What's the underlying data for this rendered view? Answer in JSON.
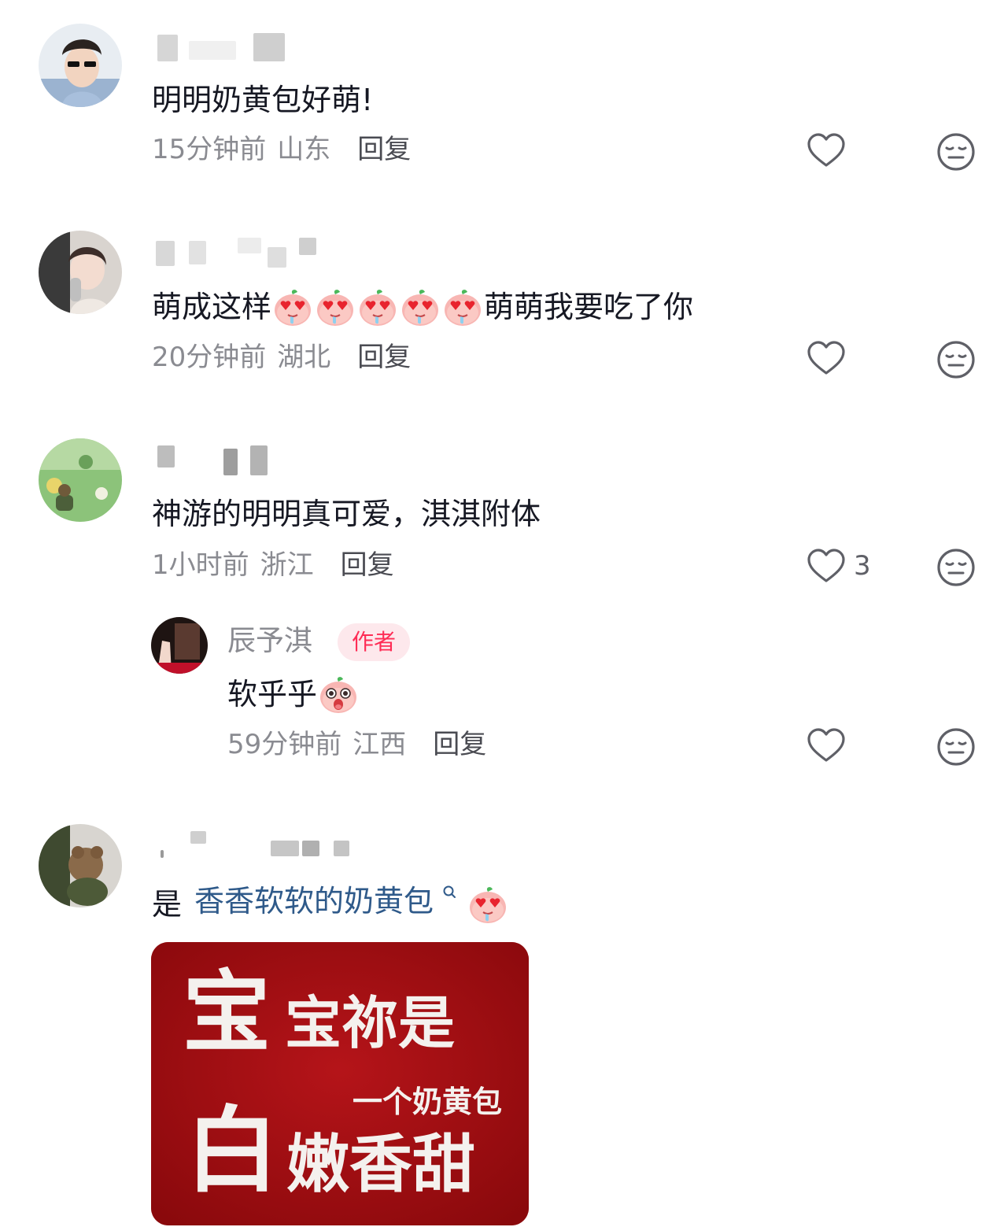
{
  "colors": {
    "text": "#161823",
    "secondary": "#8a8b91",
    "reply": "#4a4b52",
    "icon": "#5f6067",
    "author_tag_bg": "#fde8ec",
    "author_tag_text": "#fe2c55",
    "link": "#2f5a8a",
    "meme_bg": "#a00d11"
  },
  "comments": [
    {
      "text": "明明奶黄包好萌!",
      "time": "15分钟前",
      "location": "山东",
      "reply": "回复",
      "likes": ""
    },
    {
      "text_before": "萌成这样",
      "emoji": "heart-eyes-drool-emoji",
      "emoji_count": 5,
      "text_after": "萌萌我要吃了你",
      "time": "20分钟前",
      "location": "湖北",
      "reply": "回复",
      "likes": ""
    },
    {
      "text": "神游的明明真可爱，淇淇附体",
      "time": "1小时前",
      "location": "浙江",
      "reply": "回复",
      "likes": "3",
      "replies": [
        {
          "username": "辰予淇",
          "tag": "作者",
          "text": "软乎乎",
          "emoji": "surprised-peach-emoji",
          "time": "59分钟前",
          "location": "江西",
          "reply": "回复",
          "likes": ""
        }
      ]
    },
    {
      "text_prefix": "是",
      "link_text": "香香软软的奶黄包",
      "link_icon": "search-icon",
      "emoji": "heart-eyes-drool-emoji",
      "meme": {
        "line1_big": "宝",
        "line1_rest": "宝祢是",
        "line2_small": "一个奶黄包",
        "line3_big": "白",
        "line3_rest": "嫩香甜"
      }
    }
  ]
}
